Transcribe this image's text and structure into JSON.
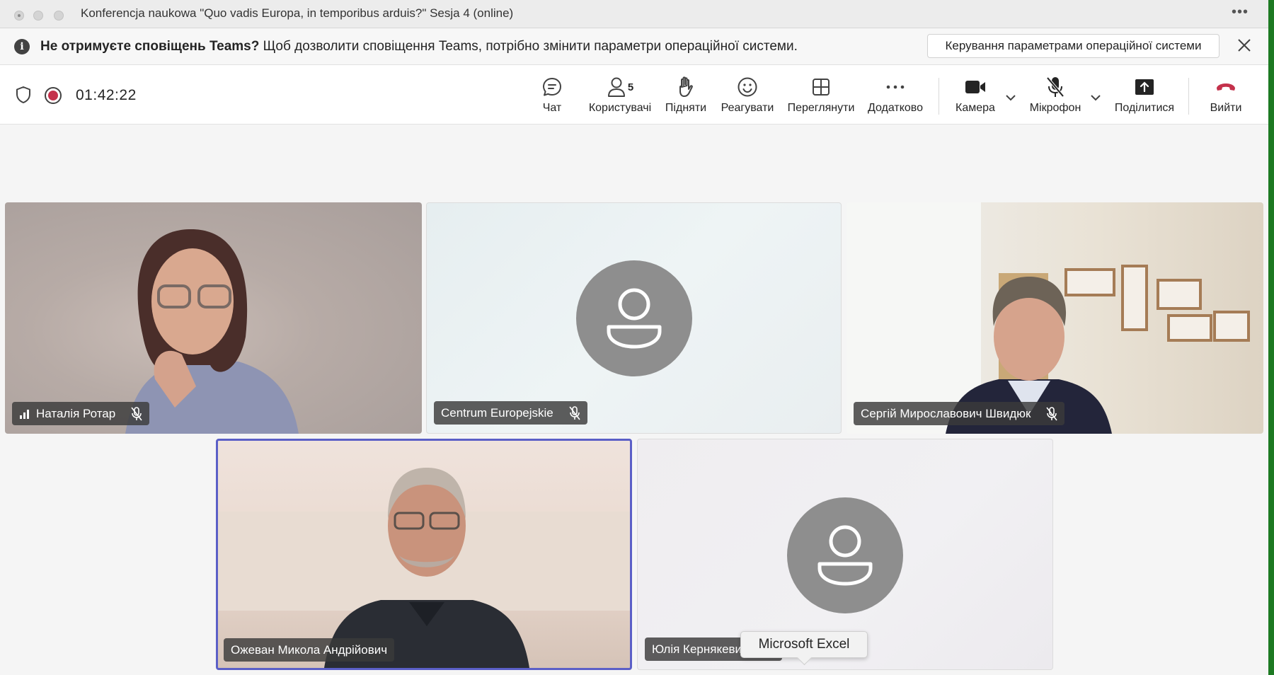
{
  "window": {
    "title": "Konferencja naukowa \"Quo vadis Europa, in temporibus arduis?\" Sesja 4 (online)"
  },
  "banner": {
    "bold_text": "Не отримуєте сповіщень Teams?",
    "text": " Щоб дозволити сповіщення Teams, потрібно змінити параметри операційної системи.",
    "button_label": "Керування параметрами операційної системи"
  },
  "toolbar": {
    "timer": "01:42:22",
    "chat_label": "Чат",
    "people_label": "Користувачі",
    "people_count": "5",
    "raise_label": "Підняти",
    "react_label": "Реагувати",
    "view_label": "Переглянути",
    "more_label": "Додатково",
    "camera_label": "Камера",
    "mic_label": "Мікрофон",
    "share_label": "Поділитися",
    "leave_label": "Вийти"
  },
  "participants": [
    {
      "name": "Наталія Ротар",
      "muted": true,
      "video": true
    },
    {
      "name": "Centrum Europejskie",
      "muted": true,
      "video": false
    },
    {
      "name": "Сергій Мирославович Швидюк",
      "muted": true,
      "video": true
    },
    {
      "name": "Ожеван Микола Андрійович",
      "muted": false,
      "video": true,
      "speaking": true
    },
    {
      "name": "Юлія Кернякевич",
      "muted": true,
      "video": false
    }
  ],
  "tooltip": {
    "text": "Microsoft Excel"
  },
  "colors": {
    "accent": "#5b5fc7",
    "record_red": "#c4314b",
    "leave_red": "#c4314b",
    "avatar_gray": "#8e8e8e"
  }
}
